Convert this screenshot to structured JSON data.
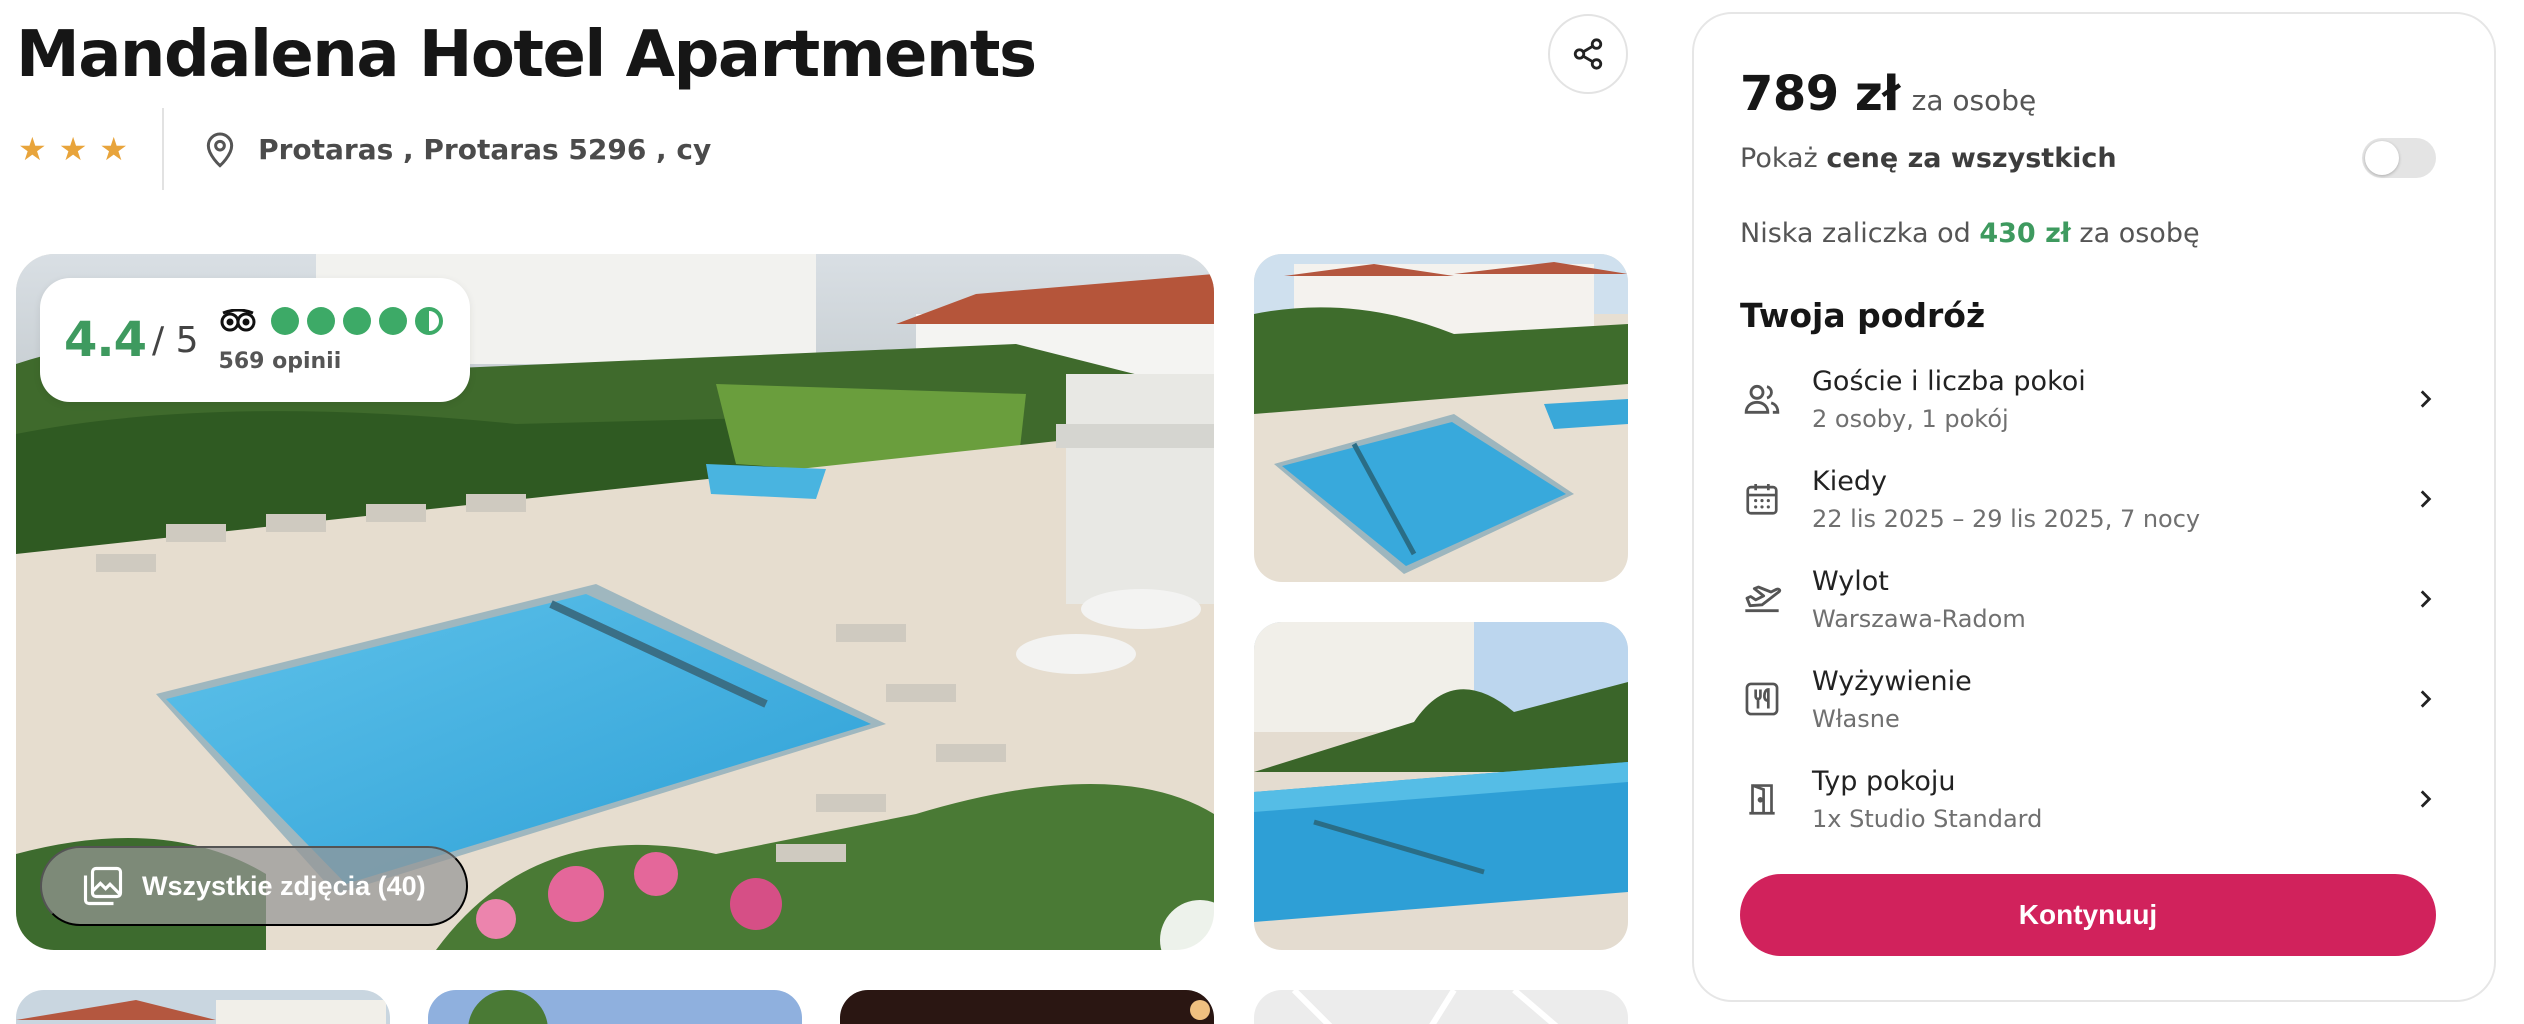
{
  "hotel": {
    "name": "Mandalena Hotel Apartments",
    "stars": 3,
    "location": "Protaras , Protaras 5296 , cy"
  },
  "rating": {
    "score": "4.4",
    "max": "/ 5",
    "reviews": "569 opinii",
    "bubbles": 4.5
  },
  "gallery": {
    "all_photos_label": "Wszystkie zdjęcia (40)"
  },
  "booking": {
    "price": "789 zł",
    "per_person": "za osobę",
    "show_total_prefix": "Pokaż ",
    "show_total_bold": "cenę za wszystkich",
    "show_total_enabled": false,
    "deposit_prefix": "Niska zaliczka od ",
    "deposit_amount": "430 zł",
    "deposit_suffix": " za osobę",
    "trip_title": "Twoja podróż",
    "options": [
      {
        "label": "Goście i liczba pokoi",
        "value": "2 osoby, 1 pokój",
        "icon": "guests-icon"
      },
      {
        "label": "Kiedy",
        "value": "22 lis 2025 – 29 lis 2025, 7 nocy",
        "icon": "calendar-icon"
      },
      {
        "label": "Wylot",
        "value": "Warszawa-Radom",
        "icon": "plane-departure-icon"
      },
      {
        "label": "Wyżywienie",
        "value": "Własne",
        "icon": "meal-icon"
      },
      {
        "label": "Typ pokoju",
        "value": "1x Studio Standard",
        "icon": "door-icon"
      }
    ],
    "continue_label": "Kontynuuj"
  },
  "colors": {
    "accent": "#d1225c",
    "rating_green": "#3e9a5f",
    "star": "#e8a43b"
  }
}
